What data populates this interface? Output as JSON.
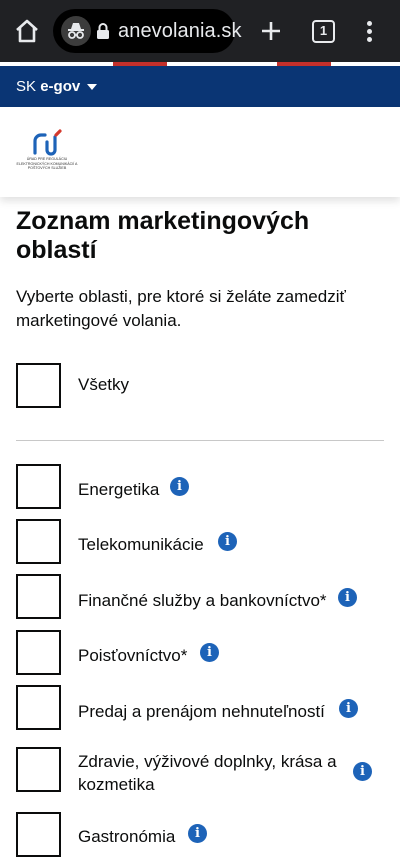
{
  "browser": {
    "url": "anevolania.sk",
    "tab_count": "1"
  },
  "gov_banner": {
    "prefix": "SK",
    "label": "e-gov"
  },
  "header": {
    "logo_text": "ÚRAD PRE REGULÁCIU ELEKTRONICKÝCH KOMUNIKÁCIÍ A POŠTOVÝCH SLUŽIEB"
  },
  "page": {
    "title": "Zoznam marketingových oblastí",
    "intro": "Vyberte oblasti, pre ktoré si želáte zamedziť marketingové volania."
  },
  "all_option": {
    "label": "Všetky",
    "checked": false
  },
  "options": [
    {
      "label": "Energetika",
      "checked": false
    },
    {
      "label": "Telekomunikácie",
      "checked": false
    },
    {
      "label": "Finančné služby a bankovníctvo*",
      "checked": false
    },
    {
      "label": "Poisťovníctvo*",
      "checked": false
    },
    {
      "label": "Predaj a prenájom nehnuteľností",
      "checked": false
    },
    {
      "label": "Zdravie, výživové doplnky, krása a kozmetika",
      "checked": false
    },
    {
      "label": "Gastronómia",
      "checked": false
    }
  ],
  "colors": {
    "gov_blue": "#0a3574",
    "info_blue": "#1d63b8",
    "chrome_dark": "#202124"
  }
}
